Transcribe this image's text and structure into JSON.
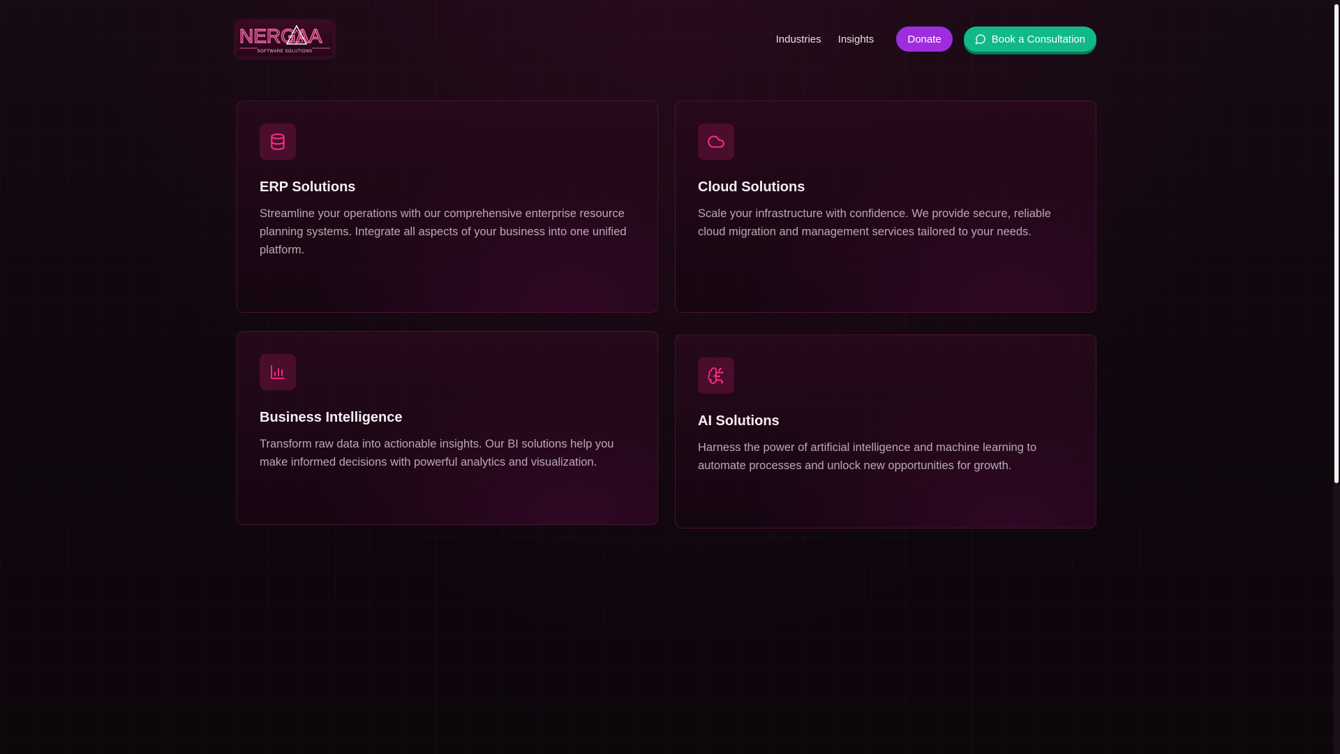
{
  "brand": {
    "logo_text": "NERGAA",
    "logo_subtitle": "SOFTWARE SOLUTIONS"
  },
  "nav": {
    "items": [
      {
        "label": "Industries"
      },
      {
        "label": "Insights"
      }
    ],
    "donate_label": "Donate",
    "consult_label": "Book a Consultation"
  },
  "colors": {
    "accent_pink": "#ff2f8a",
    "donate_bg": "#9f2de0",
    "consult_bg": "#12b988",
    "card_icon_bg": "#4a0d2c"
  },
  "cards": [
    {
      "icon": "database-icon",
      "title": "ERP Solutions",
      "description": "Streamline your operations with our comprehensive enterprise resource planning systems. Integrate all aspects of your business into one unified platform."
    },
    {
      "icon": "cloud-icon",
      "title": "Cloud Solutions",
      "description": "Scale your infrastructure with confidence. We provide secure, reliable cloud migration and management services tailored to your needs."
    },
    {
      "icon": "bar-chart-icon",
      "title": "Business Intelligence",
      "description": "Transform raw data into actionable insights. Our BI solutions help you make informed decisions with powerful analytics and visualization."
    },
    {
      "icon": "brain-icon",
      "title": "AI Solutions",
      "description": "Harness the power of artificial intelligence and machine learning to automate processes and unlock new opportunities for growth."
    }
  ]
}
